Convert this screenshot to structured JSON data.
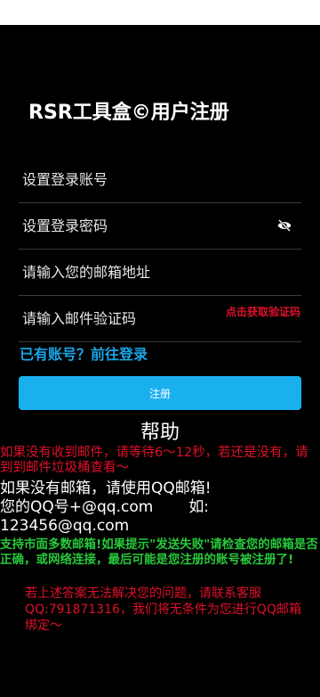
{
  "header": {
    "title": "RSR工具盒©用户注册"
  },
  "form": {
    "account_placeholder": "设置登录账号",
    "password_placeholder": "设置登录密码",
    "email_placeholder": "请输入您的邮箱地址",
    "code_placeholder": "请输入邮件验证码",
    "get_code_label": "点击获取验证码",
    "password_toggle_icon": "eye-off-icon"
  },
  "actions": {
    "login_link": "已有账号？前往登录",
    "register_button": "注册"
  },
  "help": {
    "title": "帮助",
    "red_note": "如果没有收到邮件，请等待6～12秒，若还是没有，请到到邮件垃圾桶查看～",
    "white_line1": "如果没有邮箱，请使用QQ邮箱!",
    "white_line2a": "您的QQ号+@qq.com",
    "white_line2b": "如:",
    "white_line3": "123456@qq.com",
    "green_note": "支持市面多数邮箱!如果提示\"发送失败\"请检查您的邮箱是否正确，或网络连接，最后可能是您注册的账号被注册了!",
    "contact_note": "若上述答案无法解决您的问题，请联系客服QQ:791871316，我们将无条件为您进行QQ邮箱绑定～"
  },
  "colors": {
    "background": "#000000",
    "accent_blue": "#1ab0f0",
    "link_blue": "#1aa6e8",
    "warning_red": "#e0102a",
    "note_green": "#28c83c"
  }
}
